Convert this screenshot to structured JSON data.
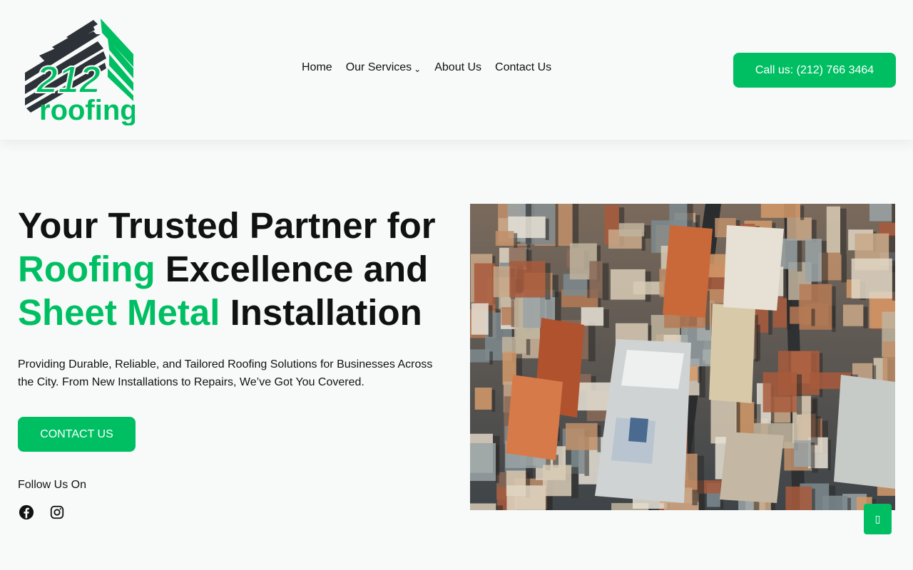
{
  "logo": {
    "number": "212",
    "word": "roofing"
  },
  "nav": {
    "items": [
      {
        "label": "Home"
      },
      {
        "label": "Our Services",
        "has_dropdown": true
      },
      {
        "label": "About Us"
      },
      {
        "label": "Contact Us"
      }
    ],
    "dropdown_glyph": "⌄"
  },
  "header": {
    "call_label": "Call us: (212) 766 3464"
  },
  "hero": {
    "title_line1": "Your Trusted Partner for",
    "title_green1": "Roofing",
    "title_line2_rest": " Excellence and",
    "title_green2": "Sheet Metal",
    "title_line3_rest": " Installation",
    "subtitle": "Providing Durable, Reliable, and Tailored Roofing Solutions for Businesses Across the City. From New Installations to Repairs, We’ve Got You Covered.",
    "cta_label": "CONTACT US",
    "follow_label": "Follow Us On",
    "image_icon": "aerial-city-photo"
  },
  "social": {
    "icons": [
      "facebook-icon",
      "instagram-icon"
    ]
  },
  "scroll_top": {
    "glyph": "▯"
  },
  "colors": {
    "accent": "#00bf63",
    "text": "#111111",
    "background": "#f8fafa",
    "logo_dark": "#2d3238"
  }
}
